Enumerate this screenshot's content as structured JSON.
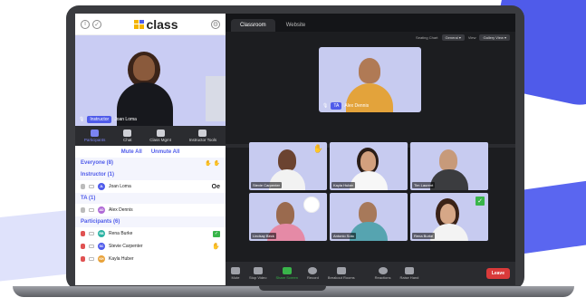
{
  "app": {
    "logo_text": "class"
  },
  "left": {
    "main_video": {
      "role": "Instructor",
      "name": "Joan Loma"
    },
    "tools": [
      {
        "label": "Participants",
        "icon": "people-icon",
        "active": true
      },
      {
        "label": "Chat",
        "icon": "chat-icon"
      },
      {
        "label": "Class Mgmt",
        "icon": "class-mgmt-icon"
      },
      {
        "label": "Instructor Tools",
        "icon": "clipboard-icon"
      }
    ],
    "mute_all": "Mute All",
    "unmute_all": "Unmute All",
    "everyone": "Everyone (8)",
    "groups": [
      {
        "title": "Instructor (1)",
        "members": [
          {
            "initials": "JL",
            "name": "Joan Loma",
            "color": "#4f5bea",
            "extra": "Oe"
          }
        ]
      },
      {
        "title": "TA (1)",
        "members": [
          {
            "initials": "AD",
            "name": "Alex Dennis",
            "color": "#b06ad6"
          }
        ]
      },
      {
        "title": "Participants (6)",
        "members": [
          {
            "initials": "RB",
            "name": "Rena Burke",
            "color": "#2bb3a3",
            "check": true
          },
          {
            "initials": "SC",
            "name": "Stevie Carpenter",
            "color": "#4f5bea",
            "hand": true
          },
          {
            "initials": "KH",
            "name": "Kayla Huber",
            "color": "#e8a23a"
          }
        ]
      }
    ]
  },
  "right": {
    "tabs": [
      "Classroom",
      "Website"
    ],
    "seating_chart_label": "Seating Chart",
    "seating_chart_value": "General",
    "view_label": "View",
    "view_value": "Gallery View",
    "stage": {
      "role": "TA",
      "name": "Alex Dennis"
    },
    "tiles": [
      {
        "name": "Stevie Carpenter",
        "hand": true
      },
      {
        "name": "Kayla Huber"
      },
      {
        "name": "Tim Laurent"
      },
      {
        "name": "Lindsay Beck"
      },
      {
        "name": "Antonio Soto"
      },
      {
        "name": "Rena Burke",
        "check": true
      }
    ],
    "bottom": [
      "Mute",
      "Stop Video",
      "Share Screen",
      "Record",
      "Breakout Rooms",
      "Reactions",
      "Raise Hand"
    ],
    "leave": "Leave"
  },
  "colors": {
    "accent": "#4f5bea",
    "leave": "#d93a3a",
    "share": "#39b54a"
  }
}
